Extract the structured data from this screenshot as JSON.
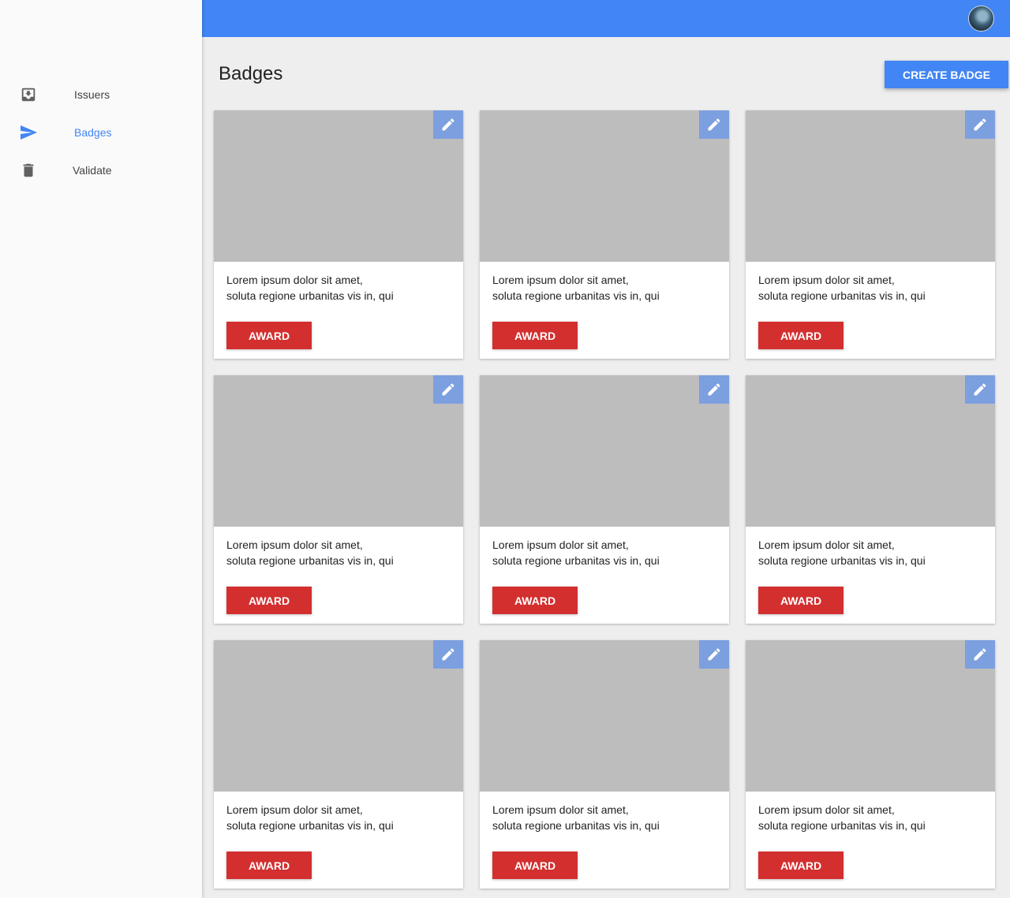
{
  "sidebar": {
    "items": [
      {
        "label": "Issuers",
        "icon": "inbox-download-icon"
      },
      {
        "label": "Badges",
        "icon": "send-icon",
        "active": true
      },
      {
        "label": "Validate",
        "icon": "trash-icon"
      }
    ]
  },
  "header": {
    "avatar": "user-avatar"
  },
  "main": {
    "title": "Badges",
    "create_label": "CREATE BADGE",
    "cards": [
      {
        "line1": "Lorem ipsum dolor sit amet,",
        "line2": "soluta regione urbanitas vis in, qui",
        "award_label": "AWARD"
      },
      {
        "line1": "Lorem ipsum dolor sit amet,",
        "line2": "soluta regione urbanitas vis in, qui",
        "award_label": "AWARD"
      },
      {
        "line1": "Lorem ipsum dolor sit amet,",
        "line2": "soluta regione urbanitas vis in, qui",
        "award_label": "AWARD"
      },
      {
        "line1": "Lorem ipsum dolor sit amet,",
        "line2": "soluta regione urbanitas vis in, qui",
        "award_label": "AWARD"
      },
      {
        "line1": "Lorem ipsum dolor sit amet,",
        "line2": "soluta regione urbanitas vis in, qui",
        "award_label": "AWARD"
      },
      {
        "line1": "Lorem ipsum dolor sit amet,",
        "line2": "soluta regione urbanitas vis in, qui",
        "award_label": "AWARD"
      },
      {
        "line1": "Lorem ipsum dolor sit amet,",
        "line2": "soluta regione urbanitas vis in, qui",
        "award_label": "AWARD"
      },
      {
        "line1": "Lorem ipsum dolor sit amet,",
        "line2": "soluta regione urbanitas vis in, qui",
        "award_label": "AWARD"
      },
      {
        "line1": "Lorem ipsum dolor sit amet,",
        "line2": "soluta regione urbanitas vis in, qui",
        "award_label": "AWARD"
      }
    ]
  },
  "colors": {
    "primary": "#4285f4",
    "accent": "#d32f2f",
    "edit_button": "#7c9fe0",
    "placeholder": "#bdbdbd"
  }
}
